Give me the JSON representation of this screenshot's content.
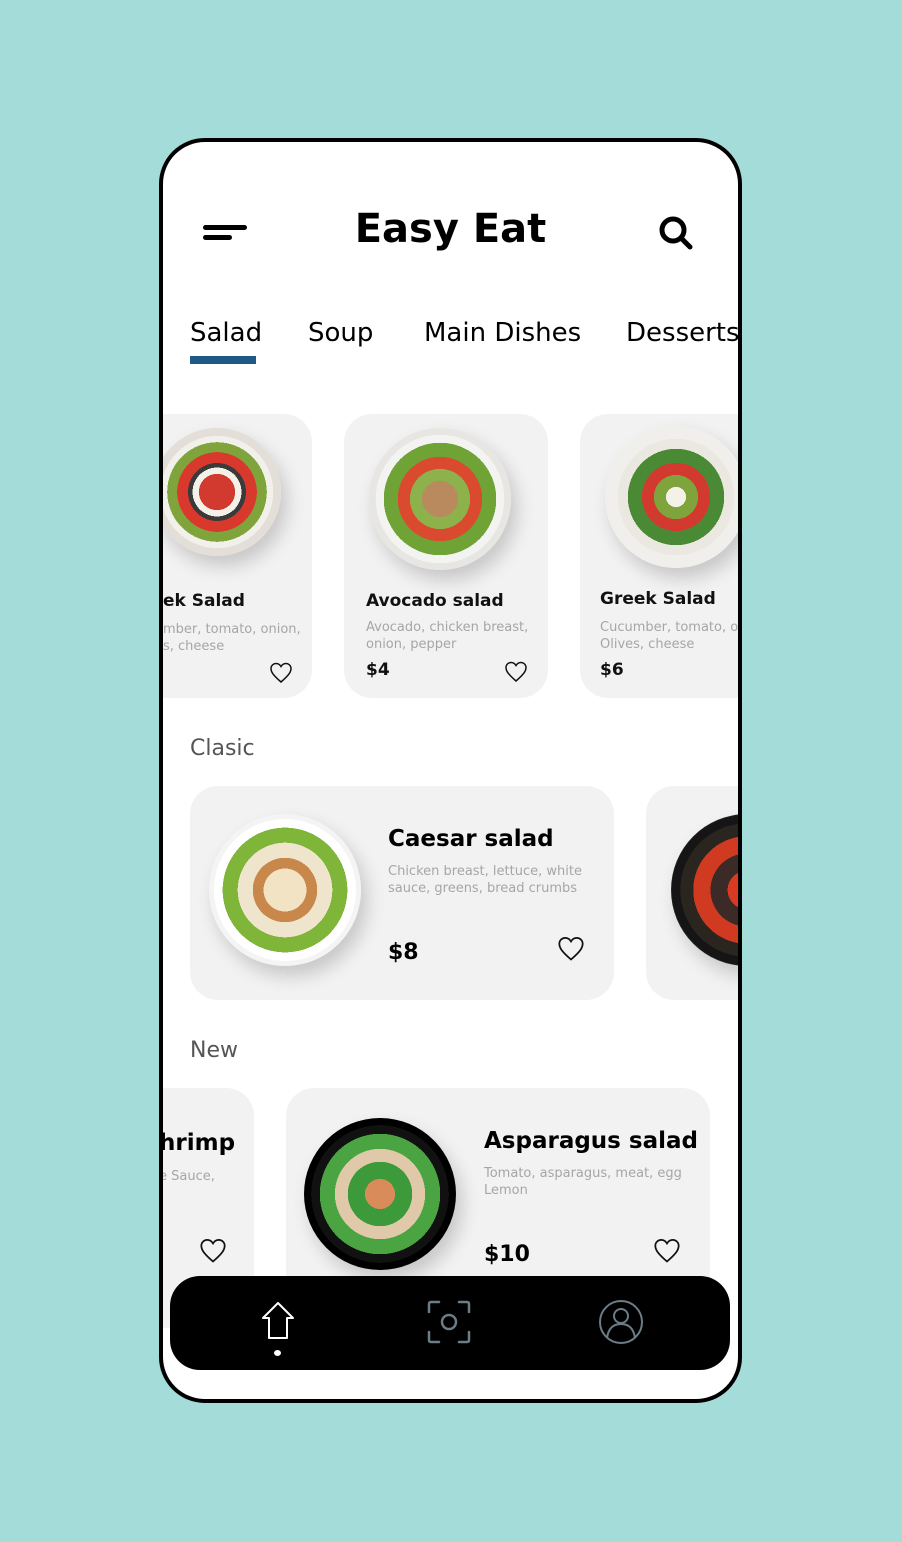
{
  "header": {
    "title": "Easy Eat",
    "menu_icon": "hamburger-menu-icon",
    "search_icon": "search-icon"
  },
  "tabs": [
    {
      "label": "Salad",
      "active": true
    },
    {
      "label": "Soup",
      "active": false
    },
    {
      "label": "Main Dishes",
      "active": false
    },
    {
      "label": "Desserts",
      "active": false
    }
  ],
  "colors": {
    "background": "#a4dcd9",
    "accent": "#1e5a85",
    "card": "#f2f2f2",
    "nav": "#000000"
  },
  "featured": [
    {
      "name": "Greek Salad",
      "visible_name": "ek Salad",
      "desc_line1": "mber, tomato, onion,",
      "desc_line2": "s, cheese",
      "price": ""
    },
    {
      "name": "Avocado salad",
      "desc_line1": "Avocado, chicken breast,",
      "desc_line2": "onion, pepper",
      "price": "$4"
    },
    {
      "name": "Greek Salad",
      "desc_line1": "Cucumber, tomato, onion,",
      "desc_line2": "Olives, cheese",
      "price": "$6"
    }
  ],
  "sections": {
    "clasic": {
      "title": "Clasic",
      "items": [
        {
          "name": "Caesar salad",
          "desc_line1": "Chicken breast, lettuce, white",
          "desc_line2": "sauce, greens, bread crumbs",
          "price": "$8"
        }
      ]
    },
    "new": {
      "title": "New",
      "items": [
        {
          "name": "Shrimp",
          "visible_name": "hrimp",
          "desc_line1": "e Sauce,",
          "desc_line2": ""
        },
        {
          "name": "Asparagus salad",
          "desc_line1": "Tomato, asparagus, meat, egg",
          "desc_line2": "Lemon",
          "price": "$10"
        }
      ]
    }
  },
  "bottom_nav": [
    {
      "icon": "home-icon",
      "active": true
    },
    {
      "icon": "scan-icon",
      "active": false
    },
    {
      "icon": "profile-icon",
      "active": false
    }
  ]
}
